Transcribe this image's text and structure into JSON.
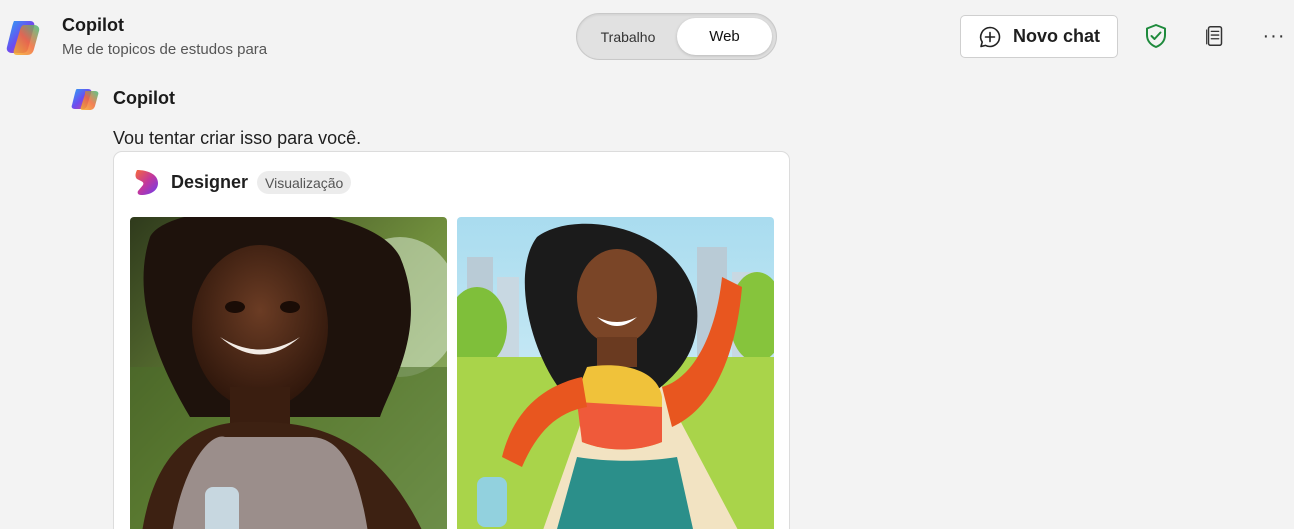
{
  "header": {
    "app_title": "Copilot",
    "app_subtitle": "Me de topicos de estudos para",
    "modes": {
      "work_label": "Trabalho",
      "web_label": "Web",
      "selected": "Web"
    },
    "new_chat_label": "Novo chat",
    "more_label": "···"
  },
  "message": {
    "author": "Copilot",
    "text": "Vou tentar criar isso para você.",
    "card": {
      "title": "Designer",
      "badge": "Visualização",
      "images": [
        {
          "icon": "photo-realistic-runner-image"
        },
        {
          "icon": "illustrated-runner-image"
        }
      ]
    }
  },
  "colors": {
    "page_bg": "#f3f3f3",
    "shield_green": "#1e8a3c",
    "toggle_bg": "#e1e1e1"
  }
}
